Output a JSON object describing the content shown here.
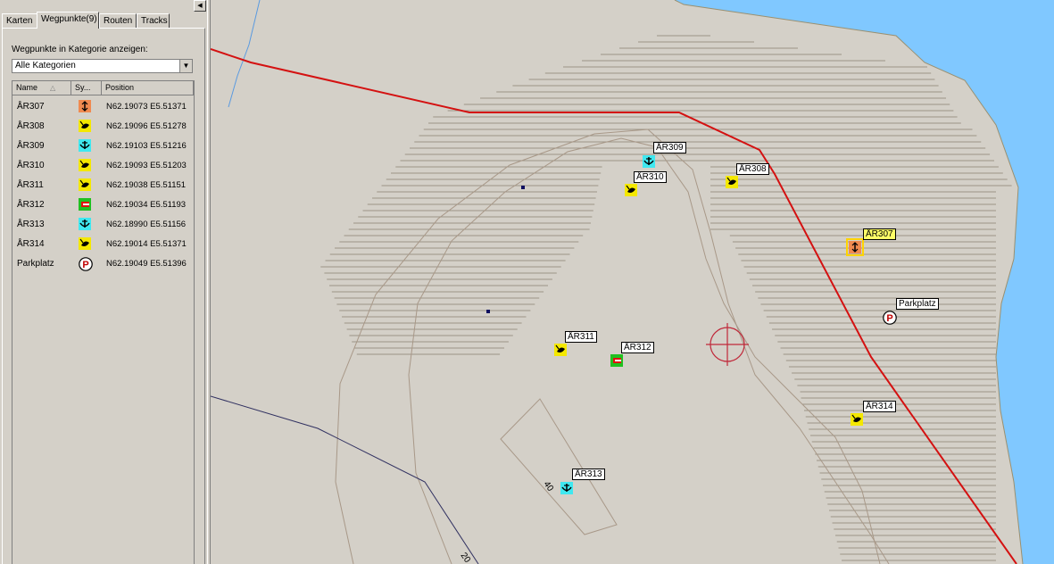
{
  "sidebar": {
    "tabs": [
      {
        "label": "Karten"
      },
      {
        "label": "Wegpunkte(9)"
      },
      {
        "label": "Routen"
      },
      {
        "label": "Tracks"
      }
    ],
    "active_tab": "Wegpunkte(9)",
    "collapse_icon": "triangle-left-icon",
    "category_label": "Wegpunkte in Kategorie anzeigen:",
    "category_value": "Alle Kategorien",
    "columns": {
      "name": "Name",
      "symbol": "Sy...",
      "position": "Position"
    },
    "waypoints": [
      {
        "name": "ÅR307",
        "symbol": "orange-arrow-icon",
        "position": "N62.19073 E5.51371"
      },
      {
        "name": "ÅR308",
        "symbol": "yellow-fish-icon",
        "position": "N62.19096 E5.51278"
      },
      {
        "name": "ÅR309",
        "symbol": "cyan-anchor-icon",
        "position": "N62.19103 E5.51216"
      },
      {
        "name": "ÅR310",
        "symbol": "yellow-fish-icon",
        "position": "N62.19093 E5.51203"
      },
      {
        "name": "ÅR311",
        "symbol": "yellow-fish-icon",
        "position": "N62.19038 E5.51151"
      },
      {
        "name": "ÅR312",
        "symbol": "green-red-marker-icon",
        "position": "N62.19034 E5.51193"
      },
      {
        "name": "ÅR313",
        "symbol": "cyan-anchor-icon",
        "position": "N62.18990 E5.51156"
      },
      {
        "name": "ÅR314",
        "symbol": "yellow-fish-icon",
        "position": "N62.19014 E5.51371"
      },
      {
        "name": "Parkplatz",
        "symbol": "parking-icon",
        "position": "N62.19049 E5.51396"
      }
    ]
  },
  "map": {
    "contour_labels": [
      "40",
      "20"
    ],
    "colors": {
      "land": "#fdf9e0",
      "water": "#80c8ff",
      "route": "#d41111",
      "contour": "#a89888",
      "hatch": "#8a8070",
      "crosshair": "#c0283a"
    },
    "markers": [
      {
        "label": "ÅR309",
        "symbol": "cyan-anchor-icon"
      },
      {
        "label": "ÅR310",
        "symbol": "yellow-fish-icon"
      },
      {
        "label": "ÅR308",
        "symbol": "yellow-fish-icon"
      },
      {
        "label": "ÅR307",
        "symbol": "orange-arrow-icon",
        "highlight": true
      },
      {
        "label": "Parkplatz",
        "symbol": "parking-icon"
      },
      {
        "label": "ÅR311",
        "symbol": "yellow-fish-icon"
      },
      {
        "label": "ÅR312",
        "symbol": "green-red-marker-icon"
      },
      {
        "label": "ÅR314",
        "symbol": "yellow-fish-icon"
      },
      {
        "label": "ÅR313",
        "symbol": "cyan-anchor-icon"
      }
    ]
  }
}
